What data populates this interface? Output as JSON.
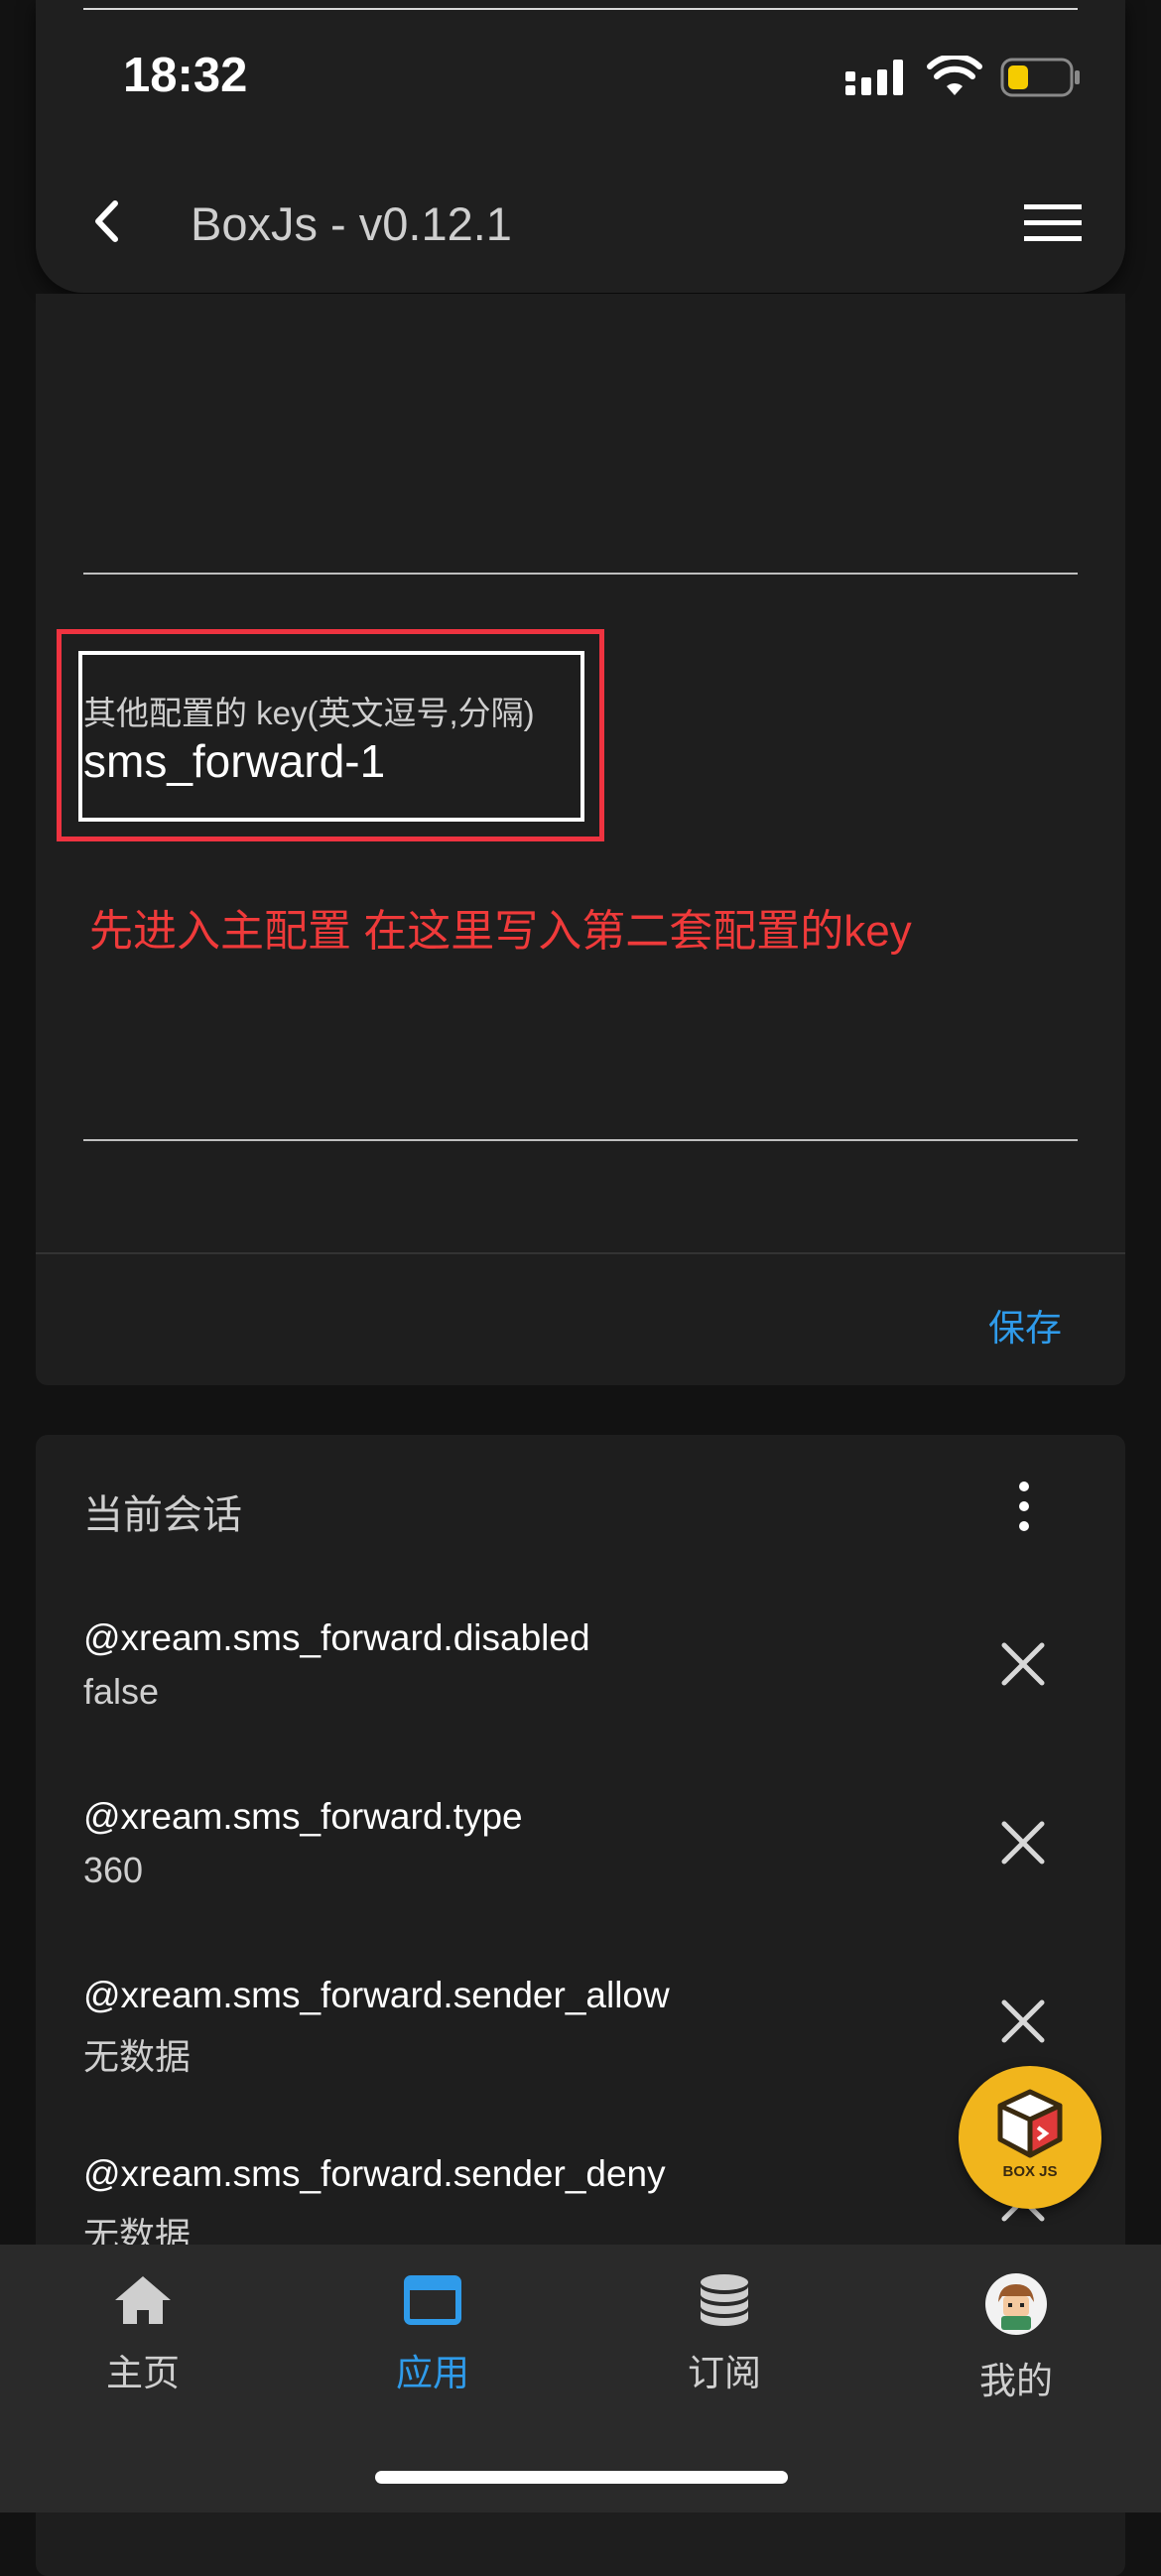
{
  "status_bar": {
    "time": "18:32"
  },
  "header": {
    "title": "BoxJs - v0.12.1"
  },
  "form": {
    "field_label": "其他配置的 key(英文逗号,分隔)",
    "field_value": "sms_forward-1",
    "annotation": "先进入主配置 在这里写入第二套配置的key",
    "save_label": "保存"
  },
  "session": {
    "title": "当前会话",
    "items": [
      {
        "key": "@xream.sms_forward.disabled",
        "value": "false"
      },
      {
        "key": "@xream.sms_forward.type",
        "value": "360"
      },
      {
        "key": "@xream.sms_forward.sender_allow",
        "value": "无数据"
      },
      {
        "key": "@xream.sms_forward.sender_deny",
        "value": "无数据"
      }
    ]
  },
  "fab": {
    "logo_text": "BOX JS"
  },
  "nav": {
    "items": [
      {
        "label": "主页",
        "icon": "home-icon"
      },
      {
        "label": "应用",
        "icon": "app-window-icon",
        "active": true
      },
      {
        "label": "订阅",
        "icon": "database-icon"
      },
      {
        "label": "我的",
        "icon": "avatar"
      }
    ]
  },
  "colors": {
    "accent": "#2f9bea",
    "annotation": "#ef3a3a",
    "highlight": "#ef3340",
    "fab": "#f1b51c"
  }
}
